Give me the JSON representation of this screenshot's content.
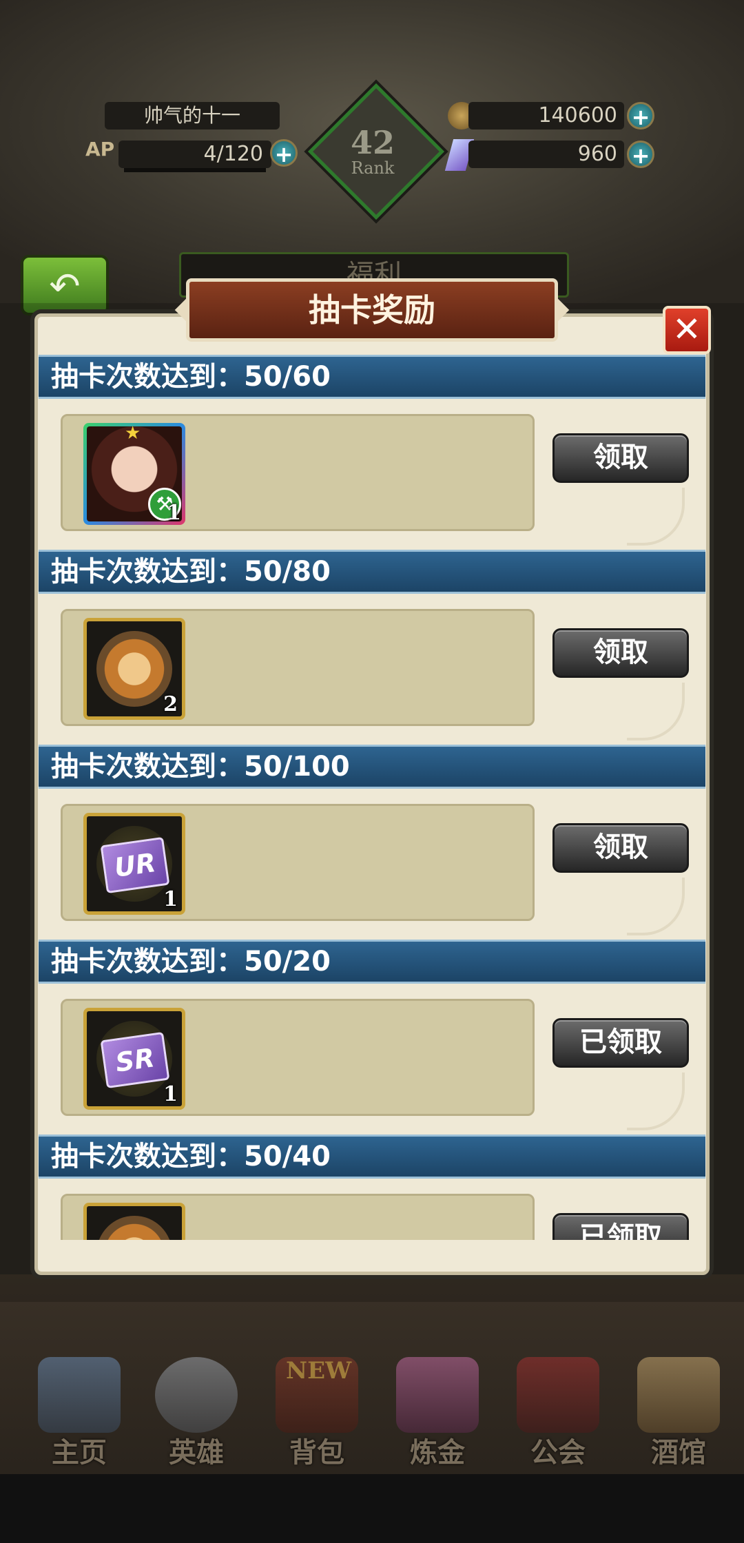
{
  "hud": {
    "player_name": "帅气的十一",
    "ap_label": "AP",
    "ap_value": "4/120",
    "gold": "140600",
    "gems": "960",
    "rank_number": "42",
    "rank_label": "Rank"
  },
  "behind_panel_title": "福利",
  "modal": {
    "title": "抽卡奖励",
    "rows": [
      {
        "header": "抽卡次数达到：50/60",
        "item": "hero-portrait",
        "count": "1",
        "button": "领取"
      },
      {
        "header": "抽卡次数达到：50/80",
        "item": "gold-crest",
        "count": "2",
        "button": "领取"
      },
      {
        "header": "抽卡次数达到：50/100",
        "item": "ur-card",
        "item_text": "UR",
        "count": "1",
        "button": "领取"
      },
      {
        "header": "抽卡次数达到：50/20",
        "item": "sr-card",
        "item_text": "SR",
        "count": "1",
        "button": "已领取"
      },
      {
        "header": "抽卡次数达到：50/40",
        "item": "gold-crest",
        "count": "",
        "button": "已领取"
      }
    ]
  },
  "nav": {
    "new_badge": "NEW",
    "items": [
      {
        "label": "主页",
        "icon": "castle-icon"
      },
      {
        "label": "英雄",
        "icon": "knight-helmet-icon"
      },
      {
        "label": "背包",
        "icon": "backpack-icon"
      },
      {
        "label": "炼金",
        "icon": "alchemy-flask-icon"
      },
      {
        "label": "公会",
        "icon": "guild-shield-icon"
      },
      {
        "label": "酒馆",
        "icon": "tavern-mug-icon"
      }
    ]
  }
}
